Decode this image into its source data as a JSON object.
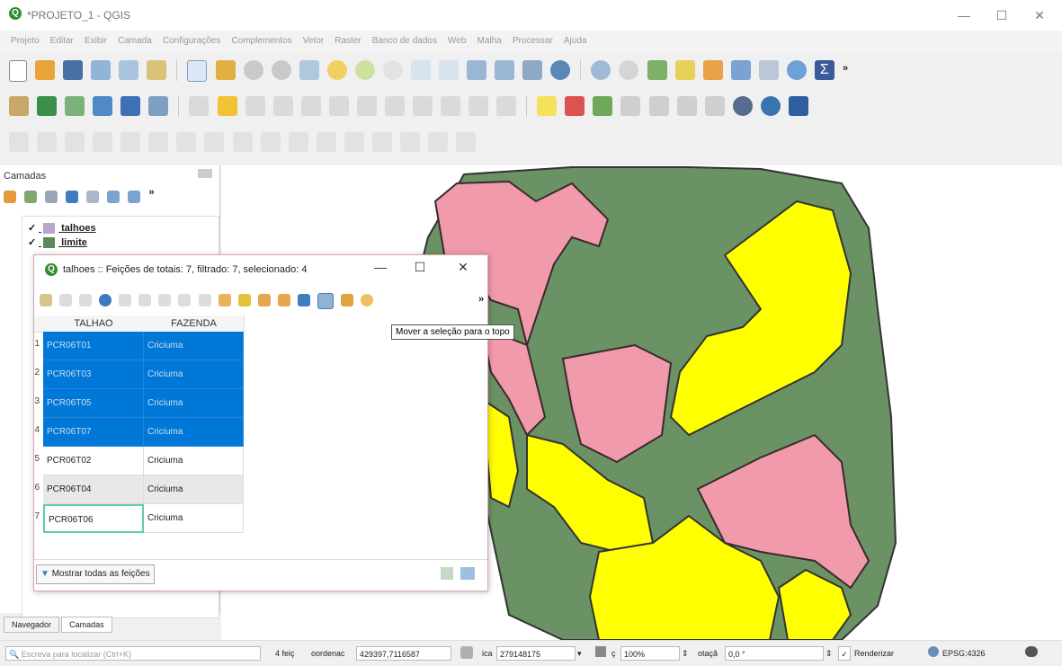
{
  "window": {
    "title": "*PROJETO_1 - QGIS",
    "minimize": "—",
    "maximize": "☐",
    "close": "✕"
  },
  "menu": [
    "Projeto",
    "Editar",
    "Exibir",
    "Camada",
    "Configurações",
    "Complementos",
    "Vetor",
    "Raster",
    "Banco de dados",
    "Web",
    "Malha",
    "Processar",
    "Ajuda"
  ],
  "toolbar_overflow": "»",
  "layers_panel": {
    "title": "Camadas",
    "overflow": "»",
    "layers": [
      {
        "name": "talhoes",
        "checked": "✓",
        "color": "#b39ddb"
      },
      {
        "name": "limite",
        "checked": "✓",
        "color": "#5a8a5a"
      }
    ]
  },
  "attribute_table": {
    "title": "talhoes :: Feições de totais: 7, filtrado: 7, selecionado: 4",
    "minimize": "—",
    "maximize": "☐",
    "close": "✕",
    "overflow": "»",
    "columns": [
      "TALHAO",
      "FAZENDA"
    ],
    "rows": [
      {
        "n": "1",
        "talhao": "PCR06T01",
        "fazenda": "Criciuma",
        "selected": true
      },
      {
        "n": "2",
        "talhao": "PCR06T03",
        "fazenda": "Criciuma",
        "selected": true
      },
      {
        "n": "3",
        "talhao": "PCR06T05",
        "fazenda": "Criciuma",
        "selected": true
      },
      {
        "n": "4",
        "talhao": "PCR06T07",
        "fazenda": "Criciuma",
        "selected": true
      },
      {
        "n": "5",
        "talhao": "PCR06T02",
        "fazenda": "Criciuma",
        "selected": false
      },
      {
        "n": "6",
        "talhao": "PCR06T04",
        "fazenda": "Criciuma",
        "selected": false
      },
      {
        "n": "7",
        "talhao": "PCR06T06",
        "fazenda": "Criciuma",
        "selected": false
      }
    ],
    "tooltip": "Mover a seleção para o topo",
    "show_all": "Mostrar todas as feições"
  },
  "bottom_tabs": [
    "Navegador",
    "Camadas"
  ],
  "status": {
    "locator_placeholder": "Escreva para localizar (Ctrl+K)",
    "features": "4 feiç",
    "coord_label": "oordenac",
    "coord": "429397,7116587",
    "scale_label": "ica",
    "scale": "279148175",
    "magnifier_label": "ç",
    "magnifier": "100%",
    "rotation_label": "otaçã",
    "rotation": "0,0 °",
    "render": "Renderizar",
    "render_checked": "✓",
    "crs": "EPSG:4326"
  },
  "colors": {
    "limit_fill": "#6b9265",
    "pink": "#f19aab",
    "yellow": "#ffff00",
    "selection": "#0078d7"
  }
}
